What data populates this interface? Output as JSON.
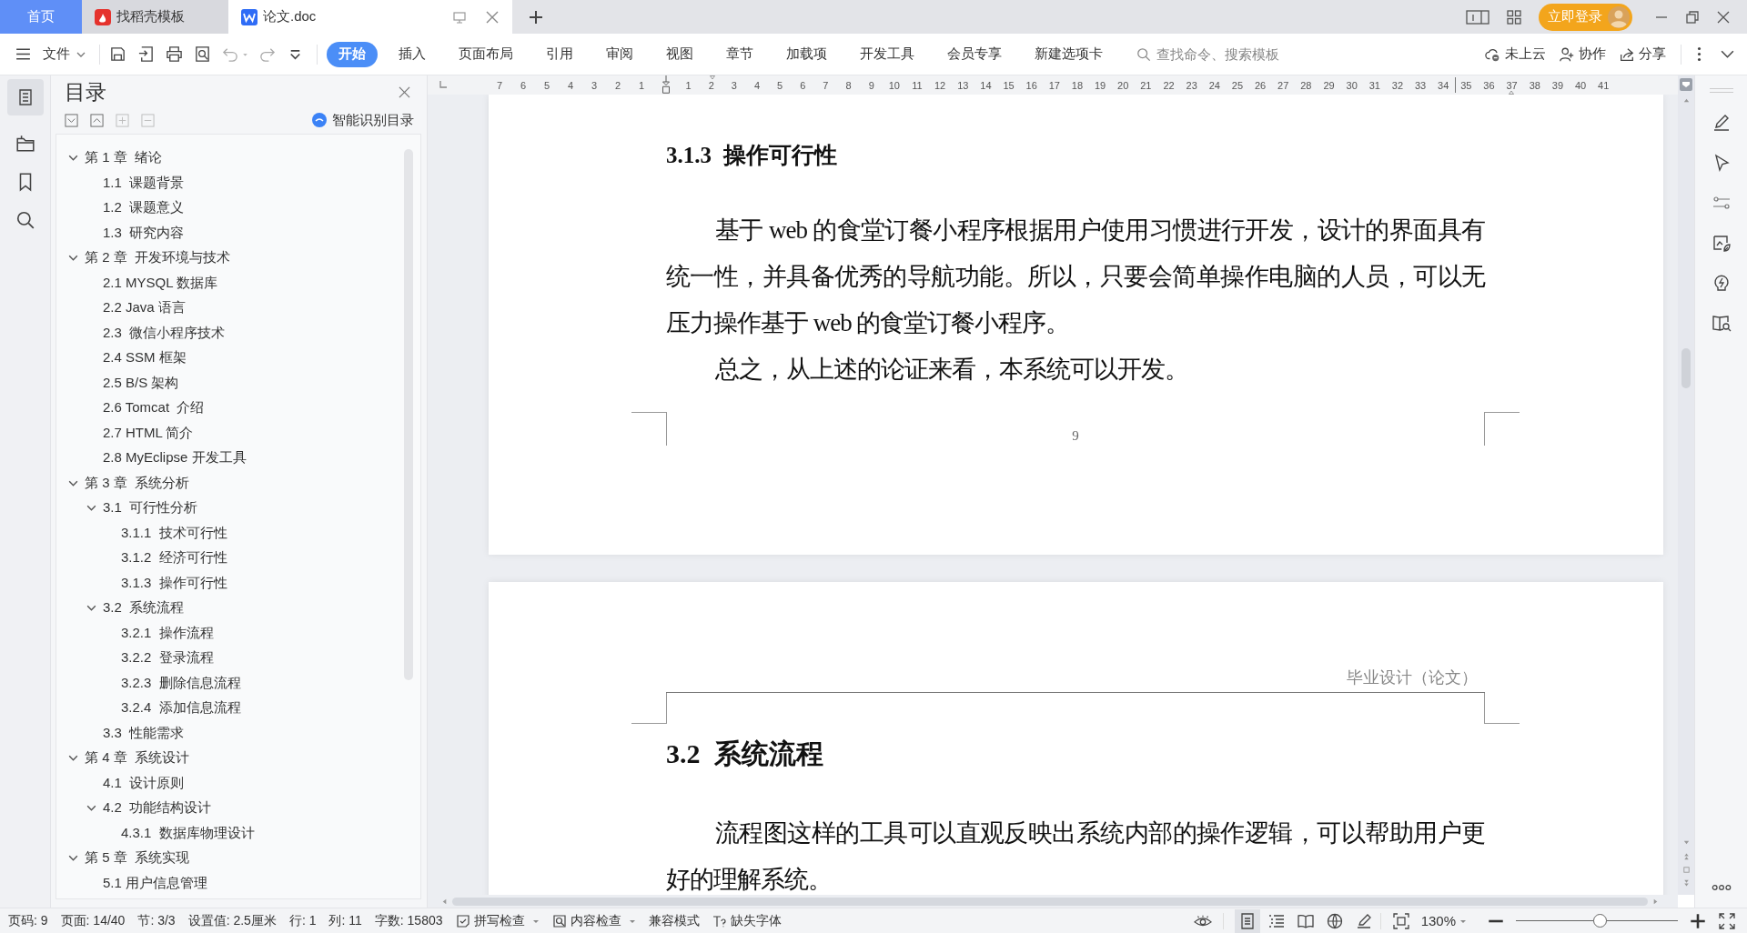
{
  "tabs": [
    {
      "label": "首页",
      "kind": "home",
      "selected": false
    },
    {
      "label": "找稻壳模板",
      "kind": "templates",
      "selected": false
    },
    {
      "label": "论文.doc",
      "kind": "doc",
      "selected": true
    }
  ],
  "login_button": "立即登录",
  "menu": {
    "file": "文件",
    "ribbon_tabs": [
      {
        "label": "开始",
        "selected": true
      },
      {
        "label": "插入",
        "selected": false
      },
      {
        "label": "页面布局",
        "selected": false
      },
      {
        "label": "引用",
        "selected": false
      },
      {
        "label": "审阅",
        "selected": false
      },
      {
        "label": "视图",
        "selected": false
      },
      {
        "label": "章节",
        "selected": false
      },
      {
        "label": "加载项",
        "selected": false
      },
      {
        "label": "开发工具",
        "selected": false
      },
      {
        "label": "会员专享",
        "selected": false
      },
      {
        "label": "新建选项卡",
        "selected": false
      }
    ],
    "search": {
      "placeholder": "查找命令、搜索模板"
    },
    "actions": [
      {
        "label": "未上云",
        "kind": "cloud"
      },
      {
        "label": "协作",
        "kind": "collab"
      },
      {
        "label": "分享",
        "kind": "share"
      }
    ]
  },
  "toc": {
    "title": "目录",
    "smart_button": "智能识别目录",
    "items": [
      {
        "label": "第 1 章  绪论",
        "expanded": true,
        "children": [
          {
            "label": "1.1  课题背景"
          },
          {
            "label": "1.2  课题意义"
          },
          {
            "label": "1.3  研究内容"
          }
        ]
      },
      {
        "label": "第 2 章  开发环境与技术",
        "expanded": true,
        "children": [
          {
            "label": "2.1 MYSQL 数据库"
          },
          {
            "label": "2.2 Java 语言"
          },
          {
            "label": "2.3  微信小程序技术"
          },
          {
            "label": "2.4 SSM 框架"
          },
          {
            "label": "2.5 B/S 架构"
          },
          {
            "label": "2.6 Tomcat  介绍"
          },
          {
            "label": "2.7 HTML 简介"
          },
          {
            "label": "2.8 MyEclipse 开发工具"
          }
        ]
      },
      {
        "label": "第 3 章  系统分析",
        "expanded": true,
        "children": [
          {
            "label": "3.1  可行性分析",
            "expanded": true,
            "children": [
              {
                "label": "3.1.1  技术可行性"
              },
              {
                "label": "3.1.2  经济可行性"
              },
              {
                "label": "3.1.3  操作可行性"
              }
            ]
          },
          {
            "label": "3.2  系统流程",
            "expanded": true,
            "children": [
              {
                "label": "3.2.1  操作流程"
              },
              {
                "label": "3.2.2  登录流程"
              },
              {
                "label": "3.2.3  删除信息流程"
              },
              {
                "label": "3.2.4  添加信息流程"
              }
            ]
          },
          {
            "label": "3.3  性能需求"
          }
        ]
      },
      {
        "label": "第 4 章  系统设计",
        "expanded": true,
        "children": [
          {
            "label": "4.1  设计原则"
          },
          {
            "label": "4.2  功能结构设计",
            "expanded": true,
            "children": [
              {
                "label": "4.3.1  数据库物理设计"
              }
            ]
          }
        ]
      },
      {
        "label": "第 5 章  系统实现",
        "expanded": true,
        "children": [
          {
            "label": "5.1 用户信息管理"
          }
        ]
      }
    ]
  },
  "ruler": {
    "left_marks": [
      "7",
      "6",
      "5",
      "4",
      "3",
      "2",
      "1"
    ],
    "right_marks": [
      "1",
      "2",
      "3",
      "4",
      "5",
      "6",
      "7",
      "8",
      "9",
      "10",
      "11",
      "12",
      "13",
      "14",
      "15",
      "16",
      "17",
      "18",
      "19",
      "20",
      "21",
      "22",
      "23",
      "24",
      "25",
      "26",
      "27",
      "28",
      "29",
      "30",
      "31",
      "32",
      "33",
      "34",
      "35",
      "36",
      "37",
      "38",
      "39",
      "40",
      "41"
    ]
  },
  "document": {
    "pages": [
      {
        "heading": {
          "text": "3.1.3  操作可行性",
          "kind": "subsection"
        },
        "paragraphs": [
          "基于 web 的食堂订餐小程序根据用户使用习惯进行开发，设计的界面具有统一性，并具备优秀的导航功能。所以，只要会简单操作电脑的人员，可以无压力操作基于 web 的食堂订餐小程序。",
          "总之，从上述的论证来看，本系统可以开发。"
        ],
        "page_number": "9"
      },
      {
        "header": "毕业设计（论文）",
        "heading": {
          "text": "3.2  系统流程",
          "kind": "section"
        },
        "paragraphs": [
          "流程图这样的工具可以直观反映出系统内部的操作逻辑，可以帮助用户更好的理解系统。"
        ]
      }
    ]
  },
  "status_bar": {
    "fields": [
      "页码: 9",
      "页面: 14/40",
      "节: 3/3",
      "设置值: 2.5厘米",
      "行: 1",
      "列: 11",
      "字数: 15803"
    ],
    "checks": [
      {
        "label": "拼写检查",
        "kind": "spell"
      },
      {
        "label": "内容检查",
        "kind": "content"
      }
    ],
    "compat": "兼容模式",
    "missing_fonts": "缺失字体",
    "views": [
      {
        "kind": "page",
        "selected": true
      },
      {
        "kind": "outline",
        "selected": false
      },
      {
        "kind": "read",
        "selected": false
      },
      {
        "kind": "web",
        "selected": false
      },
      {
        "kind": "write",
        "selected": false
      }
    ],
    "zoom": "130%",
    "zoom_slider": {
      "level": 0.52
    }
  }
}
